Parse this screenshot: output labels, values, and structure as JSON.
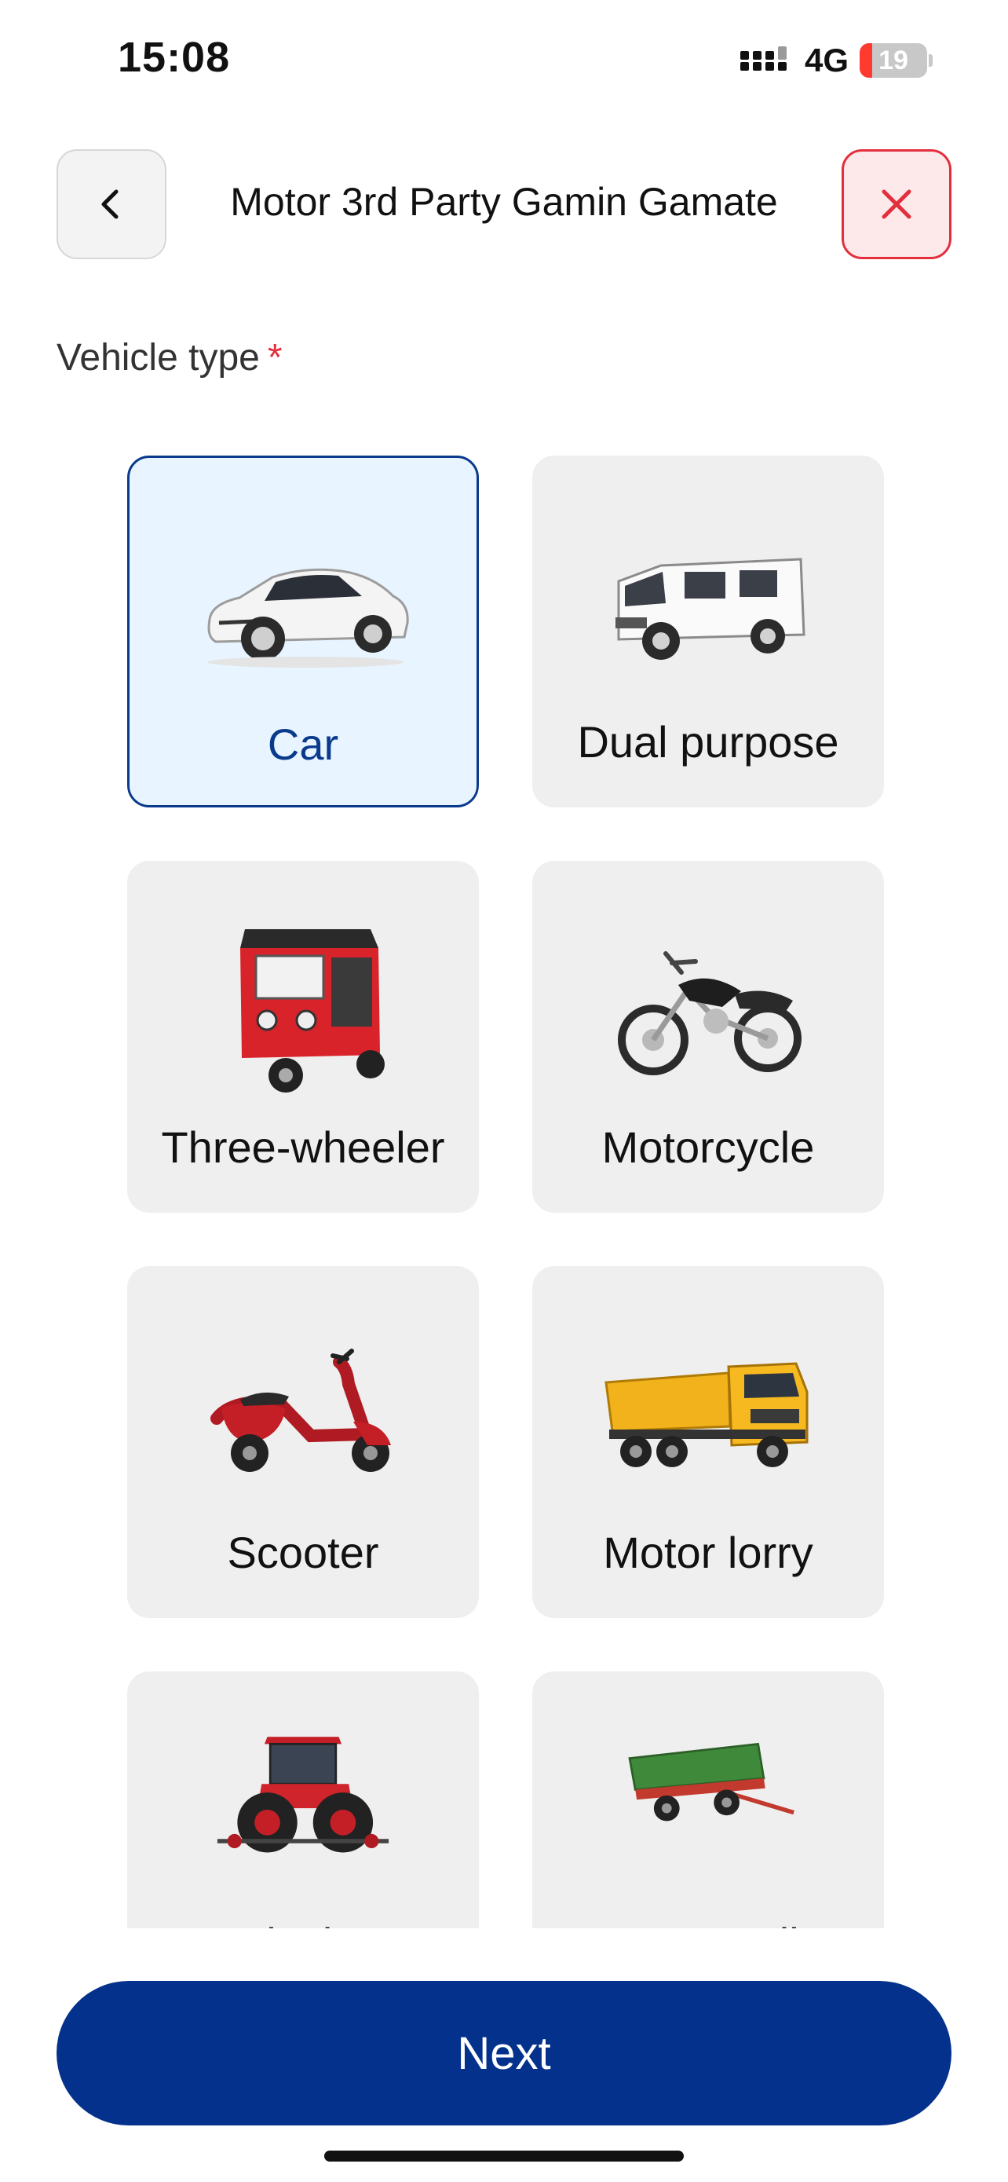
{
  "status_bar": {
    "time": "15:08",
    "network": "4G",
    "battery_level": 19,
    "battery_label": "19"
  },
  "header": {
    "title": "Motor 3rd Party Gamin Gamate",
    "back_icon": "chevron-left-icon",
    "close_icon": "close-icon"
  },
  "form": {
    "label": "Vehicle type",
    "required_mark": "*"
  },
  "vehicle_types": [
    {
      "label": "Car",
      "icon": "car-icon",
      "selected": true
    },
    {
      "label": "Dual purpose",
      "icon": "van-icon",
      "selected": false
    },
    {
      "label": "Three-wheeler",
      "icon": "three-wheeler-icon",
      "selected": false
    },
    {
      "label": "Motorcycle",
      "icon": "motorcycle-icon",
      "selected": false
    },
    {
      "label": "Scooter",
      "icon": "scooter-icon",
      "selected": false
    },
    {
      "label": "Motor lorry",
      "icon": "lorry-icon",
      "selected": false
    },
    {
      "label": "Agriculture",
      "icon": "tractor-icon",
      "selected": false
    },
    {
      "label": "Tractor trailer",
      "icon": "trailer-icon",
      "selected": false
    }
  ],
  "footer": {
    "next_label": "Next"
  },
  "colors": {
    "primary": "#04318c",
    "selected_border": "#0a3a8c",
    "selected_bg": "#e8f4ff",
    "danger": "#e32f3d",
    "danger_bg": "#fde9ea",
    "tile_bg": "#efefef"
  }
}
